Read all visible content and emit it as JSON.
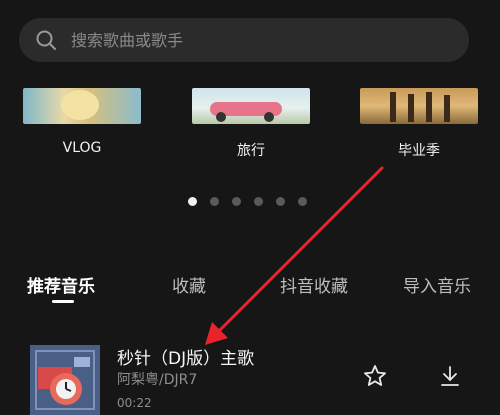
{
  "search": {
    "placeholder": "搜索歌曲或歌手"
  },
  "categories": [
    {
      "label": "VLOG"
    },
    {
      "label": "旅行"
    },
    {
      "label": "毕业季"
    }
  ],
  "carousel": {
    "pages": 6,
    "active_index": 0
  },
  "tabs": [
    {
      "label": "推荐音乐",
      "active": true
    },
    {
      "label": "收藏",
      "active": false
    },
    {
      "label": "抖音收藏",
      "active": false
    },
    {
      "label": "导入音乐",
      "active": false
    }
  ],
  "songs": [
    {
      "title": "秒针（DJ版）主歌",
      "artist": "阿梨粤/DJR7",
      "duration": "00:22"
    }
  ],
  "icons": {
    "search": "search-icon",
    "favorite": "star-icon",
    "download": "download-icon"
  },
  "colors": {
    "background": "#161616",
    "annotation_arrow": "#e8242a"
  }
}
